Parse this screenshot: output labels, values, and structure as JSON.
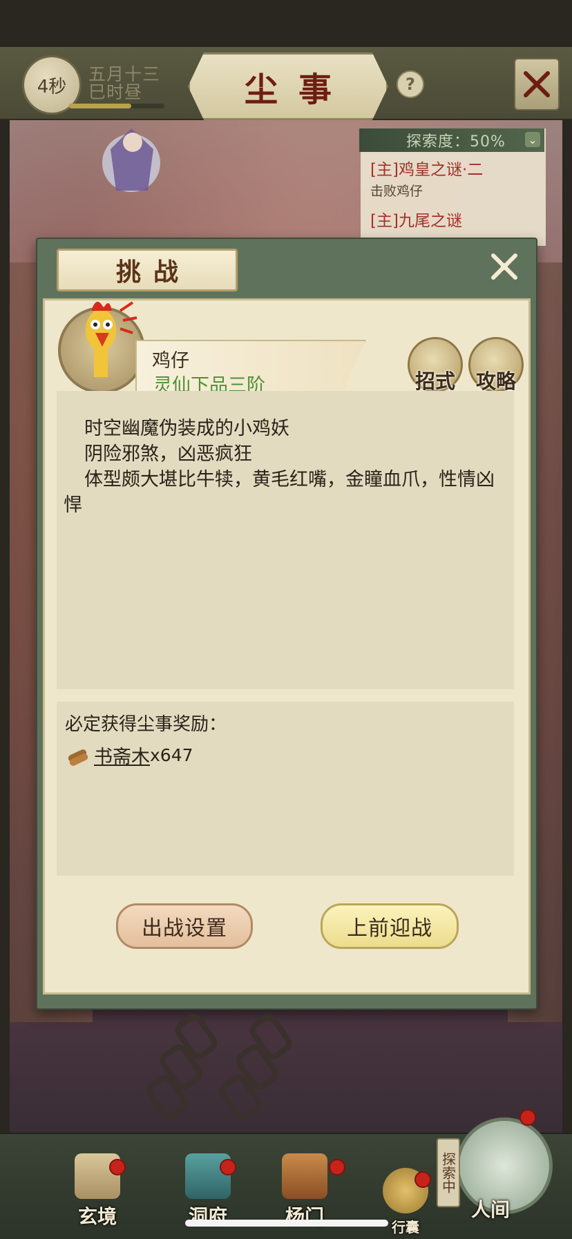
{
  "header": {
    "timer": "4秒",
    "date_line1": "五月十三",
    "date_line2": "巳时昼",
    "day_progress": 0.65,
    "title": "尘事",
    "help_icon": "question-icon",
    "close_icon": "close-x-icon"
  },
  "quest_tracker": {
    "explore_label": "探索度：50%",
    "quests": [
      {
        "title": "[主]鸡皇之谜·二",
        "subtitle": "击败鸡仔"
      },
      {
        "title": "[主]九尾之谜",
        "subtitle": ""
      }
    ]
  },
  "dialog": {
    "title": "挑战",
    "enemy": {
      "name": "鸡仔",
      "rank": "灵仙下品三阶"
    },
    "actions": {
      "moves_label": "招式",
      "guide_label": "攻略"
    },
    "description": [
      "时空幽魔伪装成的小鸡妖",
      "阴险邪煞，凶恶疯狂",
      "体型颇大堪比牛犊，黄毛红嘴，金瞳血爪，性情凶悍"
    ],
    "rewards": {
      "heading": "必定获得尘事奖励：",
      "items": [
        {
          "name": "书斋木",
          "quantity": "x647",
          "icon": "wood-log-icon"
        }
      ]
    },
    "buttons": {
      "setup": "出战设置",
      "fight": "上前迎战"
    }
  },
  "bottom_nav": {
    "items": [
      {
        "label": "玄境",
        "badge": true
      },
      {
        "label": "洞府",
        "badge": true
      },
      {
        "label": "杨门",
        "badge": true
      },
      {
        "label": "行囊",
        "badge": true
      },
      {
        "label": "人间",
        "badge": true
      }
    ],
    "exploring_label": "探索中"
  },
  "colors": {
    "accent_green": "#5f735c",
    "rank_green": "#4f8f34",
    "quest_red": "#a3302a",
    "badge_red": "#c6231b"
  }
}
